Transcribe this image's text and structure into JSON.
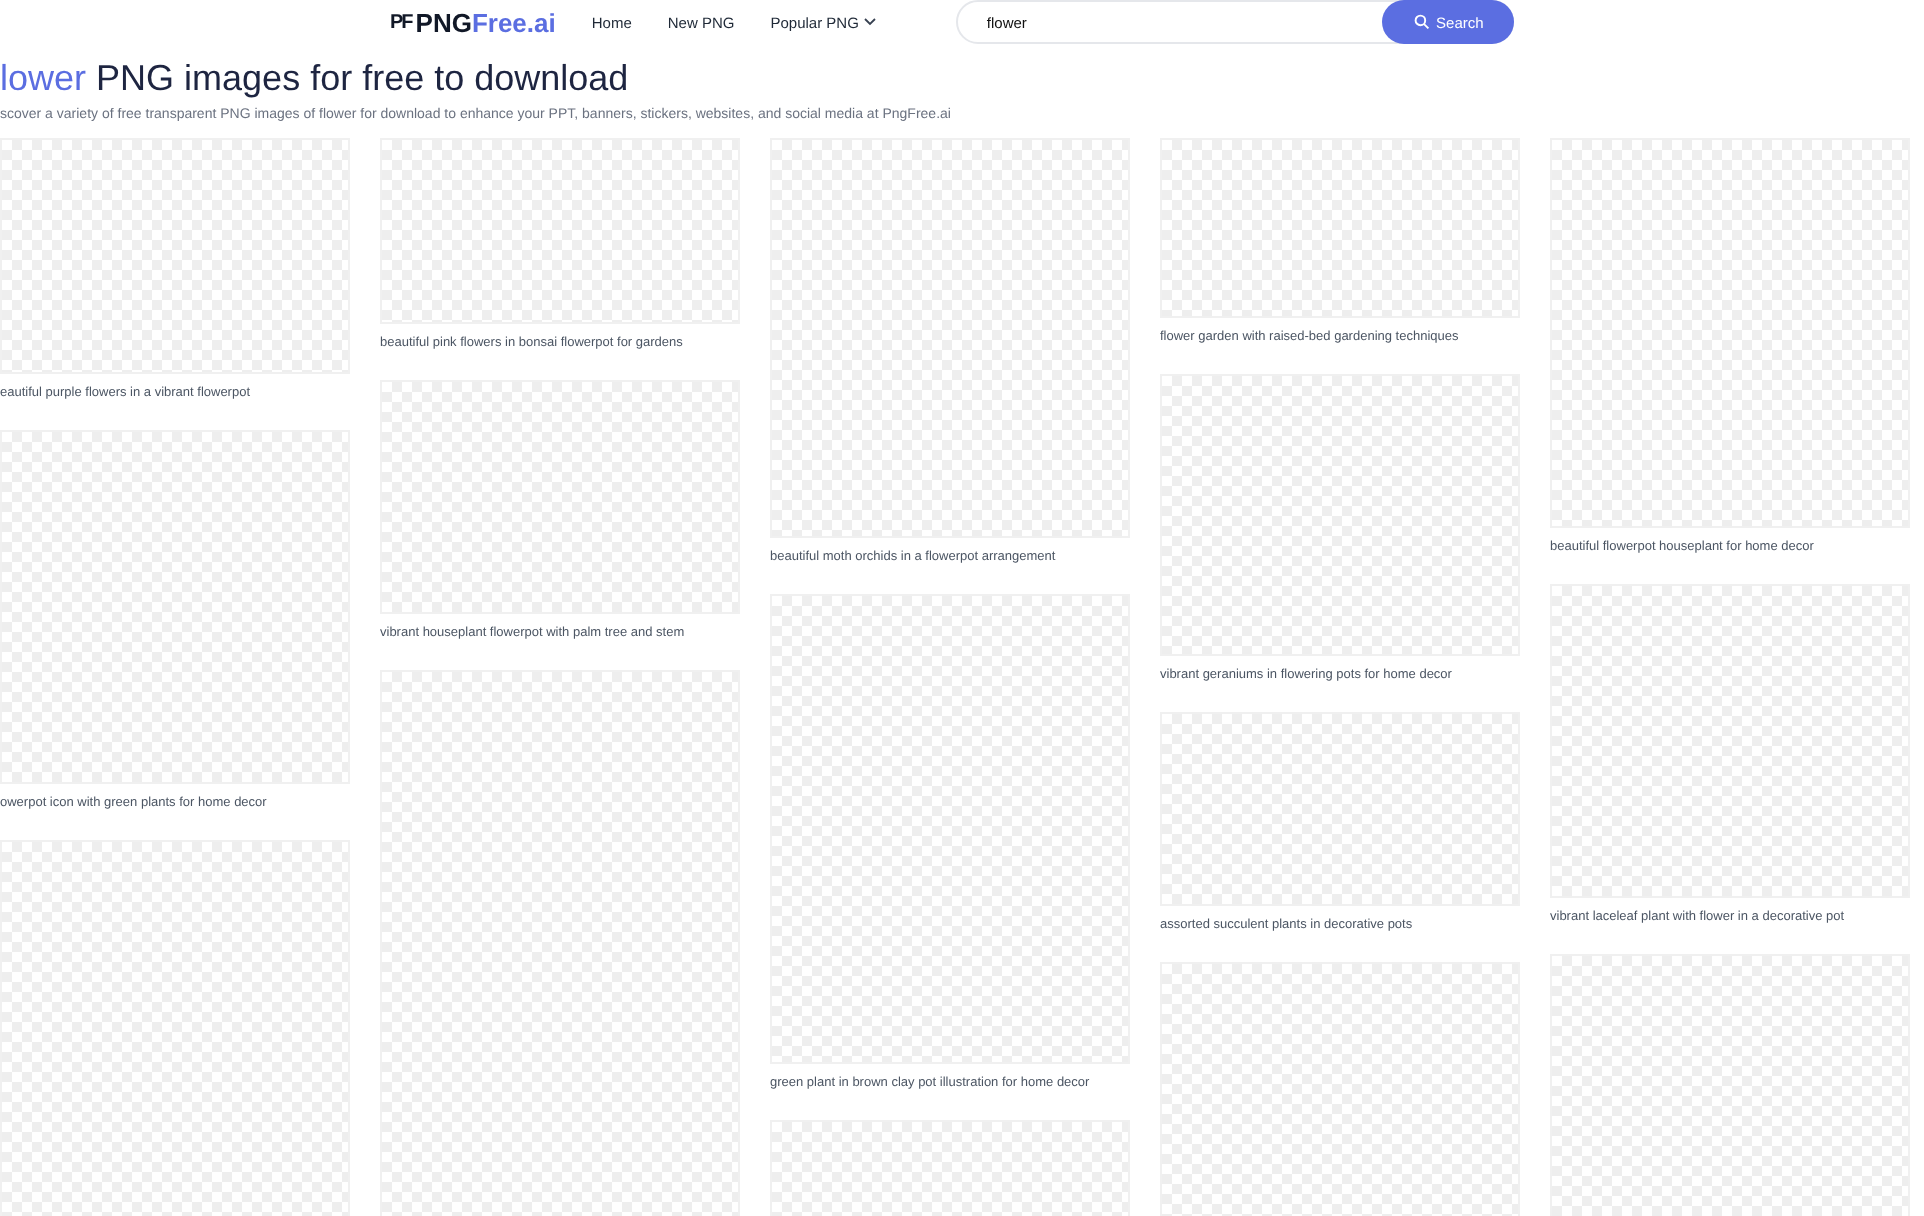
{
  "header": {
    "logo_mark": "PF",
    "logo_text": "PNG",
    "logo_accent": "Free.ai",
    "nav": [
      {
        "label": "Home",
        "kind": "link"
      },
      {
        "label": "New PNG",
        "kind": "link"
      },
      {
        "label": "Popular PNG",
        "kind": "dropdown"
      }
    ],
    "search": {
      "value": "flower",
      "button": "Search"
    }
  },
  "title": {
    "keyword": "lower",
    "rest": "PNG images for free to download"
  },
  "subtitle": "scover a variety of free transparent PNG images of flower for download to enhance your PPT, banners, stickers, websites, and social media at PngFree.ai",
  "columns": [
    {
      "tiles": [
        {
          "kind": "image",
          "caption": "eautiful purple flowers in a vibrant flowerpot"
        },
        {
          "kind": "image",
          "caption": "owerpot icon with green plants for home decor"
        },
        {
          "kind": "image"
        }
      ]
    },
    {
      "tiles": [
        {
          "kind": "image",
          "caption": "beautiful pink flowers in bonsai flowerpot for gardens"
        },
        {
          "kind": "image",
          "caption": "vibrant houseplant flowerpot with palm tree and stem"
        },
        {
          "kind": "image"
        }
      ]
    },
    {
      "tiles": [
        {
          "kind": "image",
          "caption": "beautiful moth orchids in a flowerpot arrangement"
        },
        {
          "kind": "image",
          "caption": "green plant in brown clay pot illustration for home decor"
        },
        {
          "kind": "image"
        }
      ]
    },
    {
      "tiles": [
        {
          "kind": "image",
          "caption": "flower garden with raised-bed gardening techniques"
        },
        {
          "kind": "image",
          "caption": "vibrant geraniums in flowering pots for home decor"
        },
        {
          "kind": "image",
          "caption": "assorted succulent plants in decorative pots"
        },
        {
          "kind": "image"
        }
      ]
    },
    {
      "tiles": [
        {
          "kind": "image",
          "caption": "beautiful flowerpot houseplant for home decor"
        },
        {
          "kind": "image",
          "caption": "vibrant laceleaf plant with flower in a decorative pot"
        },
        {
          "kind": "image"
        }
      ]
    }
  ]
}
